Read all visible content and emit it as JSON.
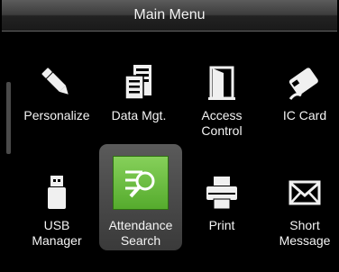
{
  "header": {
    "title": "Main Menu"
  },
  "menu": {
    "items": [
      {
        "label": "Personalize",
        "icon": "pencil-icon"
      },
      {
        "label": "Data Mgt.",
        "icon": "database-icon"
      },
      {
        "label": "Access\nControl",
        "icon": "door-icon"
      },
      {
        "label": "IC Card",
        "icon": "card-swipe-icon"
      },
      {
        "label": "USB\nManager",
        "icon": "usb-icon"
      },
      {
        "label": "Attendance\nSearch",
        "icon": "search-icon",
        "selected": true
      },
      {
        "label": "Print",
        "icon": "printer-icon"
      },
      {
        "label": "Short\nMessage",
        "icon": "envelope-icon"
      }
    ]
  },
  "colors": {
    "selected_icon_bg": "#6bbf44",
    "background": "#000000"
  }
}
